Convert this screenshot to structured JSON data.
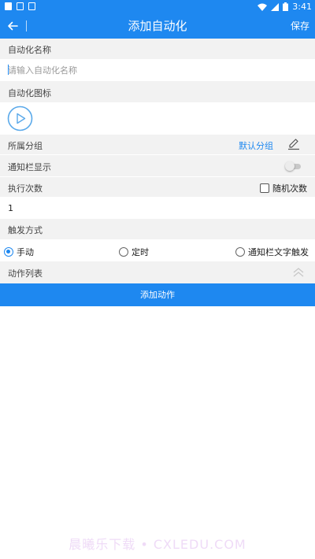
{
  "status_bar": {
    "time": "3:41",
    "icons": [
      "notification-square-icon",
      "message-icon",
      "download-icon",
      "wifi-icon",
      "signal-icon",
      "battery-icon"
    ]
  },
  "app_bar": {
    "title": "添加自动化",
    "save_label": "保存",
    "back_icon": "arrow-left-icon",
    "color": "#1e88f0"
  },
  "sections": {
    "name_label": "自动化名称",
    "name_placeholder": "请输入自动化名称",
    "name_value": "",
    "icon_label": "自动化图标",
    "icon": "play-circle-icon",
    "group_label": "所属分组",
    "group_value": "默认分组",
    "notification_label": "通知栏显示",
    "notification_enabled": false,
    "exec_label": "执行次数",
    "random_label": "随机次数",
    "random_checked": false,
    "exec_count": "1",
    "trigger_label": "触发方式",
    "triggers": [
      {
        "label": "手动",
        "selected": true
      },
      {
        "label": "定时",
        "selected": false
      },
      {
        "label": "通知栏文字触发",
        "selected": false
      }
    ],
    "action_list_label": "动作列表",
    "add_action_label": "添加动作"
  },
  "watermark": "晨曦乐下载 • CXLEDU.COM",
  "colors": {
    "accent": "#1e88f0",
    "section_bg": "#f2f2f2"
  }
}
